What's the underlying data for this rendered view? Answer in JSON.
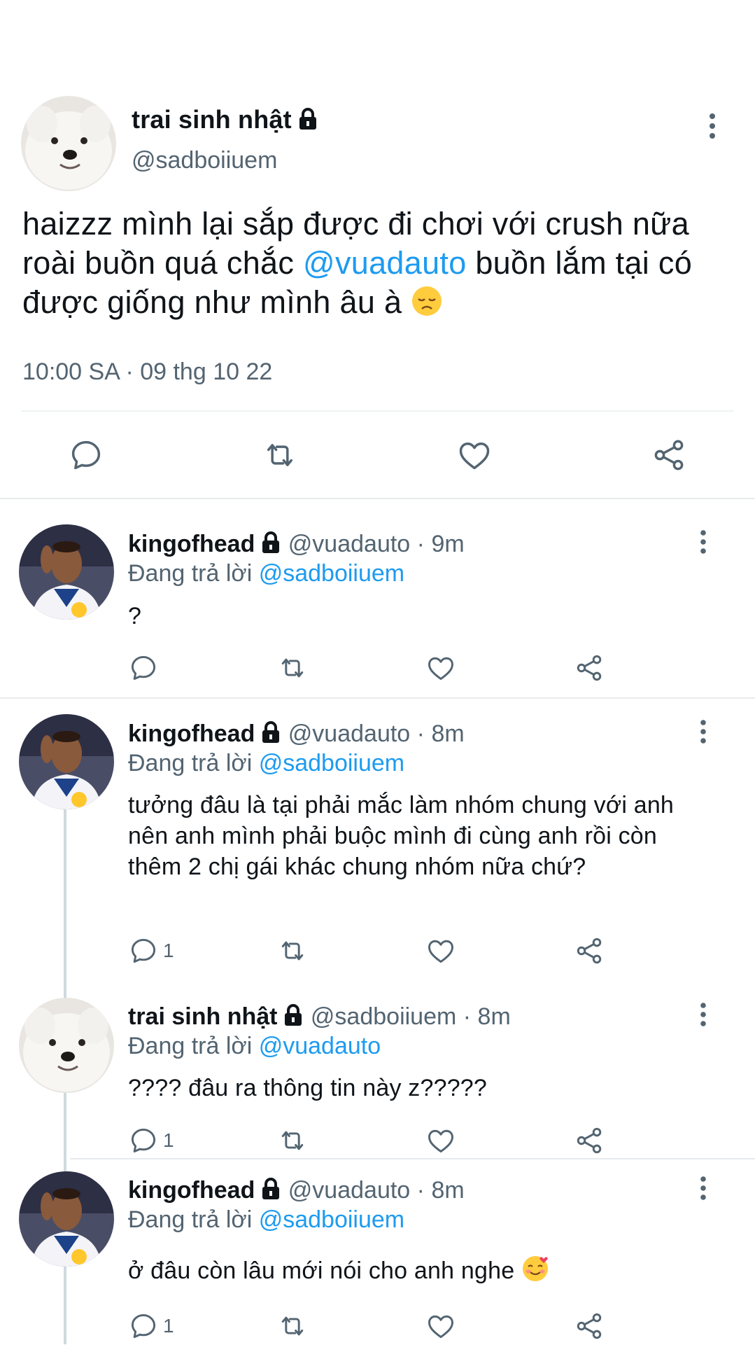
{
  "main_tweet": {
    "name": "trai sinh nhật",
    "handle": "@sadboiiuem",
    "text_before": "haizzz mình lại sắp được đi chơi với crush nữa roài buồn quá chắc ",
    "mention": "@vuadauto",
    "text_after": " buồn lắm tại có được giống như mình âu à",
    "emoji": "disappointed-face-emoji",
    "timestamp": "10:00 SA · 09 thg 10 22"
  },
  "replies": [
    {
      "name": "kingofhead",
      "handle": "@vuadauto",
      "time": "· 9m",
      "replying_to_label": "Đang trả lời",
      "replying_to": "@sadboiiuem",
      "text": "?",
      "reply_count": ""
    },
    {
      "name": "kingofhead",
      "handle": "@vuadauto",
      "time": "· 8m",
      "replying_to_label": "Đang trả lời",
      "replying_to": "@sadboiiuem",
      "text": "tưởng đâu là tại phải mắc làm nhóm chung với anh nên anh mình phải buộc mình đi cùng anh rồi còn thêm 2 chị gái khác chung nhóm nữa chứ?",
      "reply_count": "1"
    },
    {
      "name": "trai sinh nhật",
      "handle": "@sadboiiuem",
      "time": "· 8m",
      "replying_to_label": "Đang trả lời",
      "replying_to": "@vuadauto",
      "text": "???? đâu ra thông tin này z?????",
      "reply_count": "1"
    },
    {
      "name": "kingofhead",
      "handle": "@vuadauto",
      "time": "· 8m",
      "replying_to_label": "Đang trả lời",
      "replying_to": "@sadboiiuem",
      "text": "ở đâu còn lâu mới nói cho anh nghe",
      "emoji": "smiling-face-with-hearts-emoji",
      "reply_count": "1"
    }
  ],
  "colors": {
    "accent": "#1d9bf0",
    "text": "#0f1419",
    "muted": "#536471",
    "separator": "#eff3f4"
  }
}
